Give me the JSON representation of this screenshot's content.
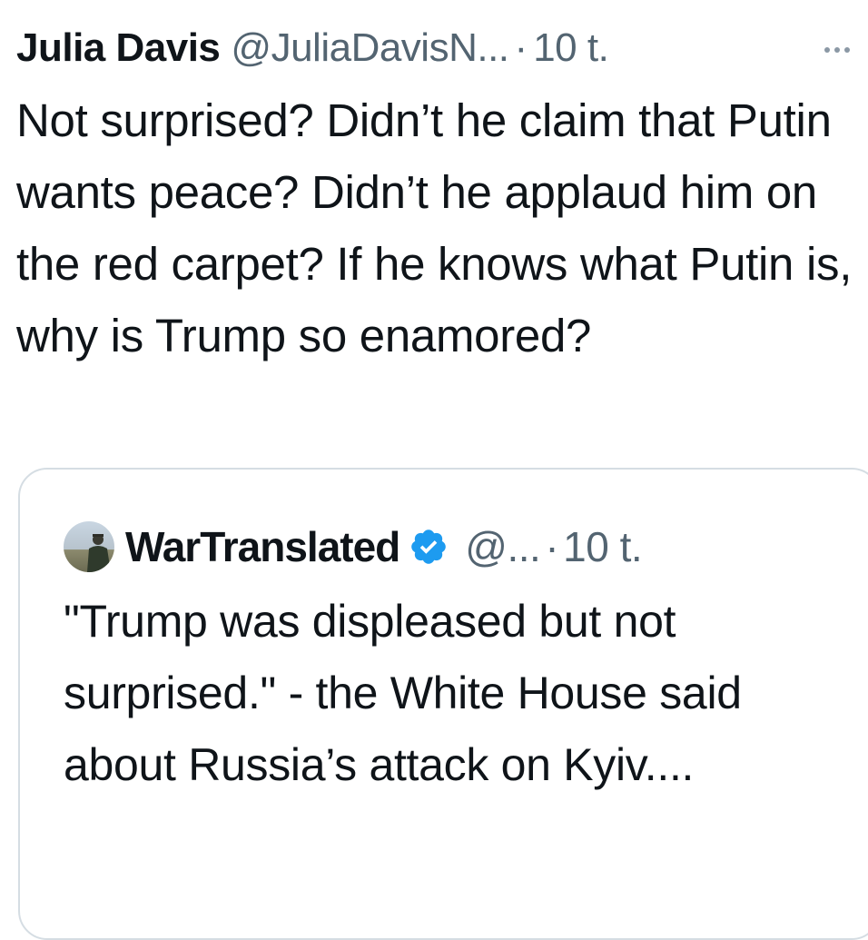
{
  "tweet": {
    "author_name": "Julia Davis",
    "handle": "@JuliaDavisN...",
    "separator": "·",
    "time": "10 t.",
    "more_icon": "more-horizontal-icon",
    "text": "Not surprised? Didn’t he claim that Putin wants peace? Didn’t he applaud him on the red carpet? If he knows what Putin is, why is Trump so enamored?"
  },
  "quoted_tweet": {
    "author_name": "WarTranslated",
    "verified_icon": "verified-badge-icon",
    "handle": "@...",
    "separator": "·",
    "time": "10 t.",
    "text": "\"Trump was displeased but not surprised.\" - the White House said about Russia’s attack on Kyiv...."
  },
  "colors": {
    "text": "#0f1419",
    "secondary": "#536471",
    "border": "#d5dde3",
    "verified": "#1d9bf0"
  }
}
